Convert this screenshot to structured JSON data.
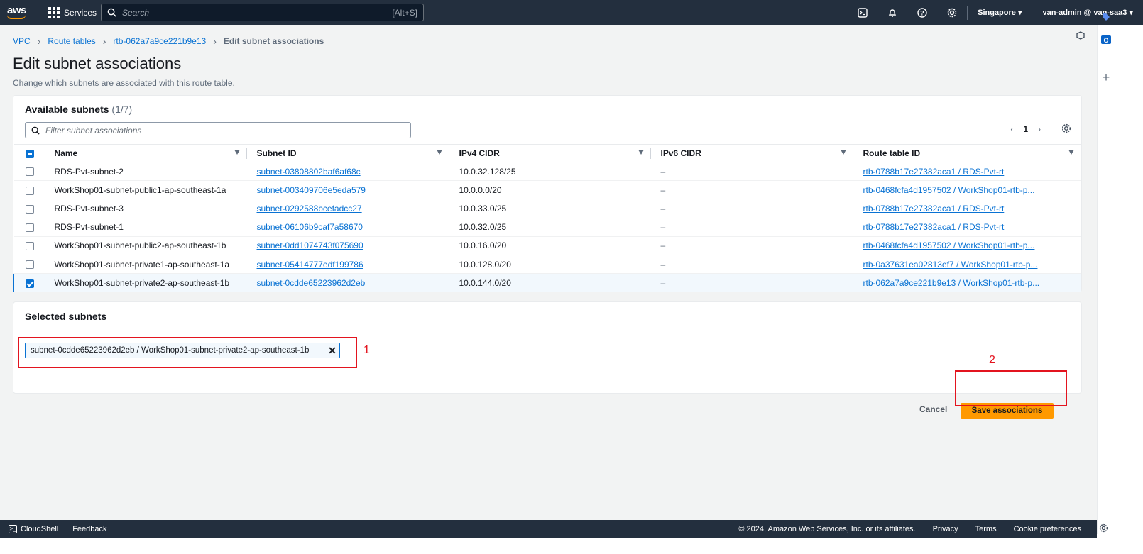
{
  "topnav": {
    "logo": "aws",
    "services_label": "Services",
    "search_placeholder": "Search",
    "search_shortcut": "[Alt+S]",
    "region": "Singapore",
    "account": "van-admin @ van-saa3"
  },
  "breadcrumb": {
    "items": [
      "VPC",
      "Route tables",
      "rtb-062a7a9ce221b9e13"
    ],
    "current": "Edit subnet associations"
  },
  "page": {
    "title": "Edit subnet associations",
    "description": "Change which subnets are associated with this route table."
  },
  "available": {
    "title": "Available subnets",
    "count": "(1/7)",
    "filter_placeholder": "Filter subnet associations",
    "page_number": "1",
    "columns": [
      "Name",
      "Subnet ID",
      "IPv4 CIDR",
      "IPv6 CIDR",
      "Route table ID"
    ],
    "rows": [
      {
        "name": "RDS-Pvt-subnet-2",
        "subnet_id": "subnet-03808802baf6af68c",
        "ipv4": "10.0.32.128/25",
        "ipv6": "–",
        "route_table": "rtb-0788b17e27382aca1 / RDS-Pvt-rt",
        "checked": false
      },
      {
        "name": "WorkShop01-subnet-public1-ap-southeast-1a",
        "subnet_id": "subnet-003409706e5eda579",
        "ipv4": "10.0.0.0/20",
        "ipv6": "–",
        "route_table": "rtb-0468fcfa4d1957502 / WorkShop01-rtb-p...",
        "checked": false
      },
      {
        "name": "RDS-Pvt-subnet-3",
        "subnet_id": "subnet-0292588bcefadcc27",
        "ipv4": "10.0.33.0/25",
        "ipv6": "–",
        "route_table": "rtb-0788b17e27382aca1 / RDS-Pvt-rt",
        "checked": false
      },
      {
        "name": "RDS-Pvt-subnet-1",
        "subnet_id": "subnet-06106b9caf7a58670",
        "ipv4": "10.0.32.0/25",
        "ipv6": "–",
        "route_table": "rtb-0788b17e27382aca1 / RDS-Pvt-rt",
        "checked": false
      },
      {
        "name": "WorkShop01-subnet-public2-ap-southeast-1b",
        "subnet_id": "subnet-0dd1074743f075690",
        "ipv4": "10.0.16.0/20",
        "ipv6": "–",
        "route_table": "rtb-0468fcfa4d1957502 / WorkShop01-rtb-p...",
        "checked": false
      },
      {
        "name": "WorkShop01-subnet-private1-ap-southeast-1a",
        "subnet_id": "subnet-05414777edf199786",
        "ipv4": "10.0.128.0/20",
        "ipv6": "–",
        "route_table": "rtb-0a37631ea02813ef7 / WorkShop01-rtb-p...",
        "checked": false
      },
      {
        "name": "WorkShop01-subnet-private2-ap-southeast-1b",
        "subnet_id": "subnet-0cdde65223962d2eb",
        "ipv4": "10.0.144.0/20",
        "ipv6": "–",
        "route_table": "rtb-062a7a9ce221b9e13 / WorkShop01-rtb-p...",
        "checked": true
      }
    ]
  },
  "selected": {
    "title": "Selected subnets",
    "token": "subnet-0cdde65223962d2eb / WorkShop01-subnet-private2-ap-southeast-1b"
  },
  "annotations": {
    "one": "1",
    "two": "2"
  },
  "actions": {
    "cancel": "Cancel",
    "save": "Save associations"
  },
  "footer": {
    "cloudshell": "CloudShell",
    "feedback": "Feedback",
    "copyright": "© 2024, Amazon Web Services, Inc. or its affiliates.",
    "privacy": "Privacy",
    "terms": "Terms",
    "cookies": "Cookie preferences"
  },
  "colors": {
    "nav": "#232f3e",
    "accent": "#ff9900",
    "link": "#0972d3",
    "annotation": "#e3141f"
  }
}
